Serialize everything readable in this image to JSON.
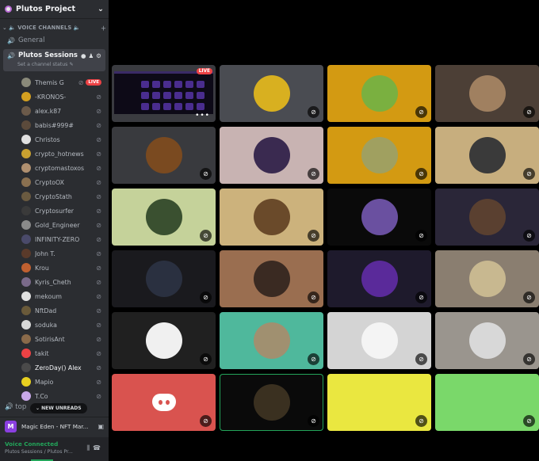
{
  "server": {
    "name": "Plutos Project",
    "chevron_icon": "chevron-down-icon"
  },
  "category": {
    "label": "VOICE CHANNELS"
  },
  "channels": {
    "general": "General",
    "active": "Plutos Sessions",
    "status_placeholder": "Set a channel status"
  },
  "users": [
    {
      "name": "Themis G",
      "color": "#8a8a7a",
      "live": true,
      "live_label": "LIVE"
    },
    {
      "name": "-KRONOS-",
      "color": "#d4a020"
    },
    {
      "name": "alex.k87",
      "color": "#6b5a4a"
    },
    {
      "name": "babis#999#",
      "color": "#5b4a3b"
    },
    {
      "name": "Christos",
      "color": "#e0e0e0"
    },
    {
      "name": "crypto_hotnews",
      "color": "#c8a030"
    },
    {
      "name": "cryptomastoxos",
      "color": "#b09070"
    },
    {
      "name": "CryptoOX",
      "color": "#8a7050"
    },
    {
      "name": "CryptoStath",
      "color": "#6a5a40"
    },
    {
      "name": "Cryptosurfer",
      "color": "#3a3a3a"
    },
    {
      "name": "Gold_Engineer",
      "color": "#8a8a8a"
    },
    {
      "name": "INFINITY-ZERO",
      "color": "#4a4a6a"
    },
    {
      "name": "John T.",
      "color": "#5a3a2a"
    },
    {
      "name": "Krou",
      "color": "#c06030"
    },
    {
      "name": "Kyris_Cheth",
      "color": "#7a6a8a"
    },
    {
      "name": "mekoum",
      "color": "#e0e0e0"
    },
    {
      "name": "NftDad",
      "color": "#6a5a3a"
    },
    {
      "name": "soduka",
      "color": "#d8d8d8"
    },
    {
      "name": "SotirisAnt",
      "color": "#8a6a4a"
    },
    {
      "name": "takit",
      "color": "#ed4245"
    },
    {
      "name": "ZeroDay() Alex",
      "color": "#4a4a4a",
      "highlight": true
    },
    {
      "name": "Mapio",
      "color": "#e8d020"
    },
    {
      "name": "T.Co",
      "color": "#c8a8e8"
    }
  ],
  "bottom": {
    "top_channel": "top",
    "new_unreads": "NEW UNREADS",
    "activity_badge": "M",
    "activity_text": "Magic Eden - NFT Mar...",
    "voice_status": "Voice Connected",
    "voice_path": "Plutos Sessions / Plutos Pr..."
  },
  "tiles": [
    {
      "bg": "#3a3b40",
      "screen": true,
      "live_label": "LIVE",
      "more": "•••"
    },
    {
      "bg": "#4a4c52",
      "av": "#d8b020"
    },
    {
      "bg": "#d39a12",
      "av": "#7ab040"
    },
    {
      "bg": "#4c3f36",
      "av": "#a08060"
    },
    {
      "bg": "#393a3e",
      "av": "#7a4a20"
    },
    {
      "bg": "#c8b3b2",
      "av": "#3a2a50"
    },
    {
      "bg": "#d39a12",
      "av": "#a0a060"
    },
    {
      "bg": "#c7ae7e",
      "av": "#3a3a3a"
    },
    {
      "bg": "#c5d29a",
      "av": "#3a5030"
    },
    {
      "bg": "#ccb27c",
      "av": "#6a4a2a"
    },
    {
      "bg": "#0a0a0a",
      "av": "#6a50a0"
    },
    {
      "bg": "#2a2638",
      "av": "#5a4030"
    },
    {
      "bg": "#1a1a1e",
      "av": "#2a3040"
    },
    {
      "bg": "#9a6e50",
      "av": "#3a2a22"
    },
    {
      "bg": "#1e1a2c",
      "av": "#5a2a9a"
    },
    {
      "bg": "#8a7e70",
      "av": "#c8b890"
    },
    {
      "bg": "#202020",
      "av": "#f0f0f0"
    },
    {
      "bg": "#4fb89c",
      "av": "#a09070"
    },
    {
      "bg": "#d4d4d4",
      "av": "#f4f4f4"
    },
    {
      "bg": "#9a958e",
      "av": "#d8d8d8"
    },
    {
      "bg": "#d9534f",
      "discord": true
    },
    {
      "bg": "#0a0a0a",
      "av": "#3a3020",
      "speaking": true
    },
    {
      "bg": "#eae740",
      "av": "#eae740"
    },
    {
      "bg": "#7ad86a",
      "av": "#7ad86a"
    }
  ],
  "icons": {
    "mic_muted": "mic-muted-icon",
    "chat": "chat-icon",
    "add_user": "add-user-icon",
    "gear": "gear-icon"
  }
}
